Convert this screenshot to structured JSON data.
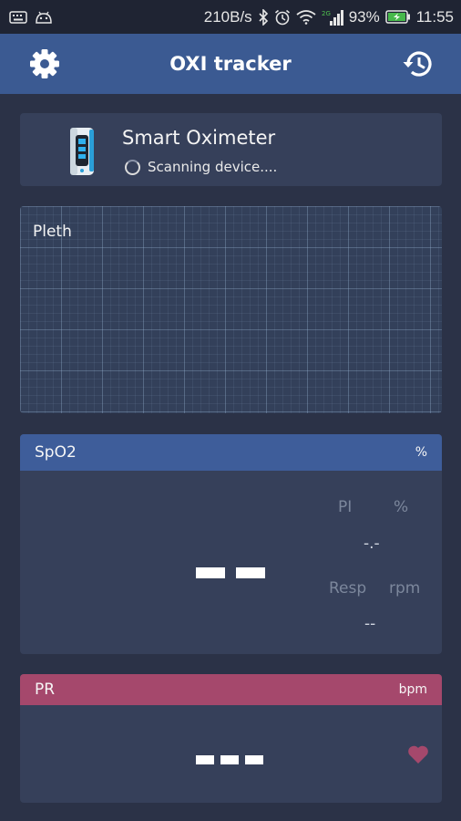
{
  "status_bar": {
    "net_speed": "210B/s",
    "battery_percent": "93%",
    "time": "11:55"
  },
  "app_bar": {
    "title": "OXI tracker",
    "settings_icon": "gear-icon",
    "history_icon": "history-icon"
  },
  "device": {
    "name": "Smart Oximeter",
    "status": "Scanning device...."
  },
  "pleth": {
    "label": "Pleth"
  },
  "spo2": {
    "title": "SpO2",
    "unit": "%",
    "value_placeholder": "- -",
    "pi_label": "PI",
    "pi_unit": "%",
    "pi_value": "-.-",
    "resp_label": "Resp",
    "resp_unit": "rpm",
    "resp_value": "--"
  },
  "pr": {
    "title": "PR",
    "unit": "bpm",
    "value_placeholder": "- - -",
    "heart_icon": "heart-icon"
  },
  "colors": {
    "background": "#2b3247",
    "app_bar": "#3b5a92",
    "card": "#36405a",
    "spo2_header": "#3e5d9a",
    "pr_header": "#a5486c",
    "heart": "#a5486c"
  }
}
